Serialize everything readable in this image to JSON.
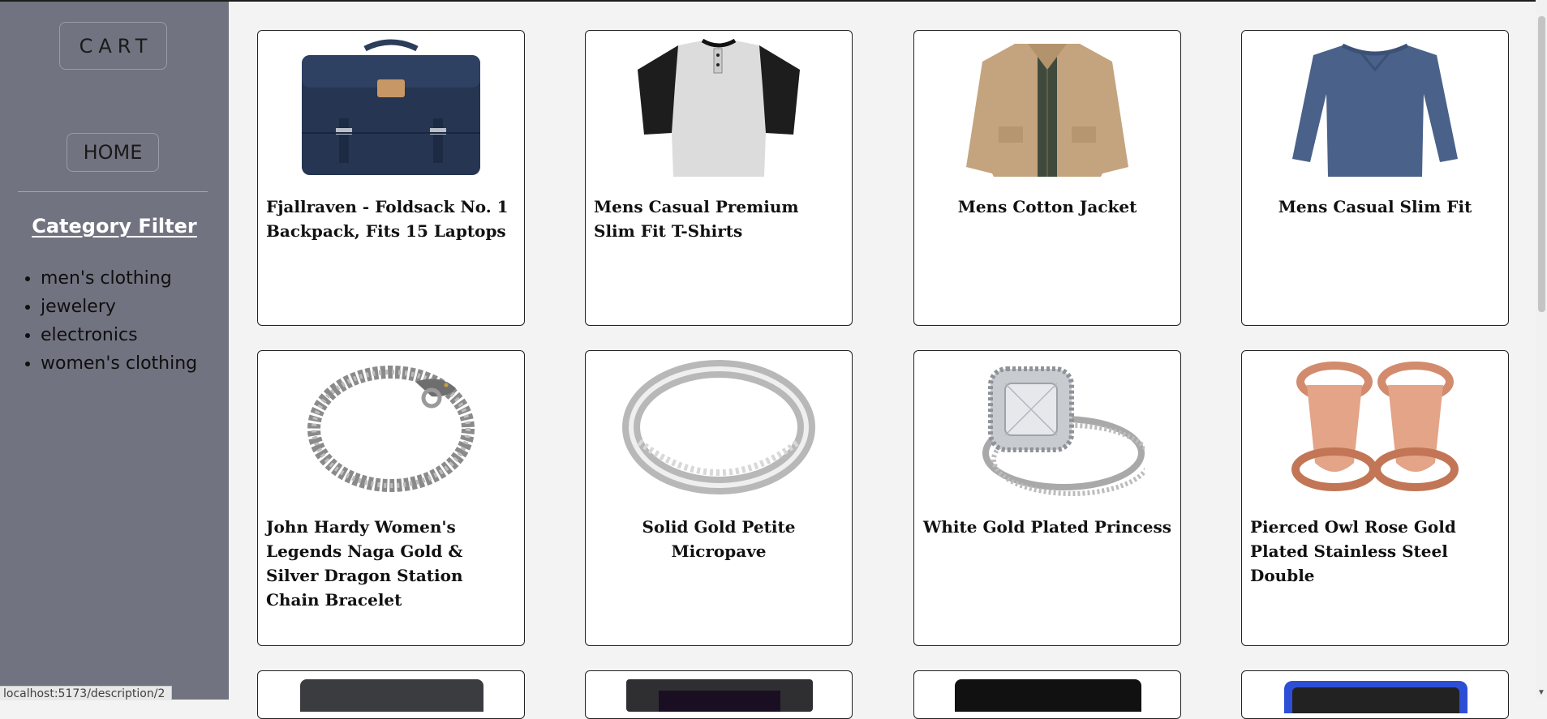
{
  "sidebar": {
    "cart_label": "CART",
    "home_label": "HOME",
    "filter_title": "Category Filter",
    "categories": [
      "men's clothing",
      "jewelery",
      "electronics",
      "women's clothing"
    ]
  },
  "products": [
    {
      "title": "Fjallraven - Foldsack No. 1 Backpack, Fits 15 Laptops",
      "icon": "backpack-image"
    },
    {
      "title": "Mens Casual Premium Slim Fit T-Shirts",
      "icon": "tshirt-image"
    },
    {
      "title": "Mens Cotton Jacket",
      "icon": "jacket-image"
    },
    {
      "title": "Mens Casual Slim Fit",
      "icon": "longsleeve-image"
    },
    {
      "title": "John Hardy Women's Legends Naga Gold & Silver Dragon Station Chain Bracelet",
      "icon": "bracelet-image"
    },
    {
      "title": "Solid Gold Petite Micropave",
      "icon": "ring-image"
    },
    {
      "title": "White Gold Plated Princess",
      "icon": "diamond-ring-image"
    },
    {
      "title": "Pierced Owl Rose Gold Plated Stainless Steel Double",
      "icon": "rose-gold-plugs-image"
    }
  ],
  "status_url": "localhost:5173/description/2",
  "colors": {
    "sidebar_bg": "#727380",
    "page_bg": "#f3f3f3",
    "card_bg": "#ffffff"
  }
}
